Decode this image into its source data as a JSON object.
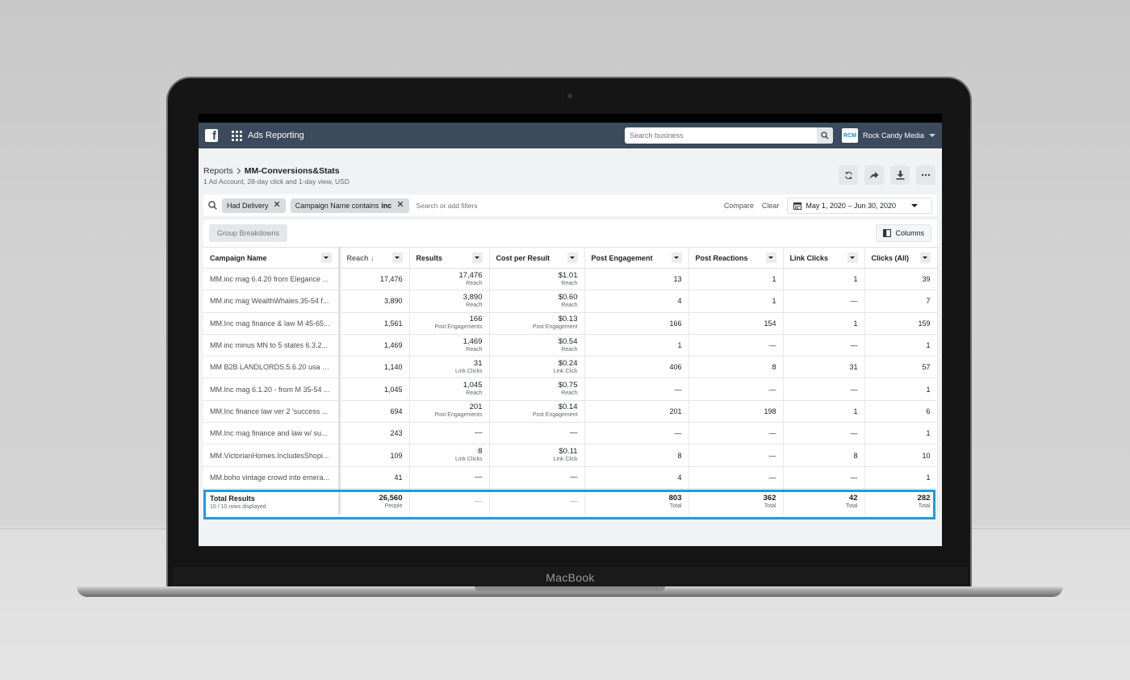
{
  "device": {
    "label": "MacBook"
  },
  "topbar": {
    "app_title": "Ads Reporting",
    "search_placeholder": "Search business",
    "account_logo_text": "RCM",
    "account_name": "Rock Candy Media"
  },
  "header": {
    "breadcrumb_root": "Reports",
    "report_name": "MM-Conversions&Stats",
    "subtitle": "1 Ad Account, 28-day click and 1-day view, USD"
  },
  "filters": {
    "chips": [
      {
        "label": "Had Delivery",
        "bold": ""
      },
      {
        "label": "Campaign Name contains",
        "bold": "inc"
      }
    ],
    "input_placeholder": "Search or add filters",
    "compare_label": "Compare",
    "clear_label": "Clear",
    "date_range": "May 1, 2020 – Jun 30, 2020"
  },
  "tools": {
    "group_breakdowns": "Group Breakdowns",
    "columns": "Columns"
  },
  "table": {
    "columns": [
      "Campaign Name",
      "Reach ↓",
      "Results",
      "Cost per Result",
      "Post Engagement",
      "Post Reactions",
      "Link Clicks",
      "Clicks (All)"
    ],
    "rows": [
      {
        "name": "MM.inc mag 6.4.20 from Elegance ...",
        "reach": "17,476",
        "results": "17,476",
        "results_sub": "Reach",
        "cpr": "$1.01",
        "cpr_sub": "Reach",
        "engagement": "13",
        "reactions": "1",
        "link_clicks": "1",
        "clicks_all": "39"
      },
      {
        "name": "MM.inc mag WealthWhales.35-54 f...",
        "reach": "3,890",
        "results": "3,890",
        "results_sub": "Reach",
        "cpr": "$0.60",
        "cpr_sub": "Reach",
        "engagement": "4",
        "reactions": "1",
        "link_clicks": "—",
        "clicks_all": "7"
      },
      {
        "name": "MM.Inc mag finance & law M 45-65...",
        "reach": "1,561",
        "results": "166",
        "results_sub": "Post Engagements",
        "cpr": "$0.13",
        "cpr_sub": "Post Engagement",
        "engagement": "166",
        "reactions": "154",
        "link_clicks": "1",
        "clicks_all": "159"
      },
      {
        "name": "MM inc minus MN to 5 states 6.3.2...",
        "reach": "1,469",
        "results": "1,469",
        "results_sub": "Reach",
        "cpr": "$0.54",
        "cpr_sub": "Reach",
        "engagement": "1",
        "reactions": "—",
        "link_clicks": "—",
        "clicks_all": "1"
      },
      {
        "name": "MM B2B LANDLORDS.5.6.20 usa fb...",
        "reach": "1,140",
        "results": "31",
        "results_sub": "Link Clicks",
        "cpr": "$0.24",
        "cpr_sub": "Link Click",
        "engagement": "406",
        "reactions": "8",
        "link_clicks": "31",
        "clicks_all": "57"
      },
      {
        "name": "MM.Inc mag 6.1.20 - from M 35-54 ...",
        "reach": "1,045",
        "results": "1,045",
        "results_sub": "Reach",
        "cpr": "$0.75",
        "cpr_sub": "Reach",
        "engagement": "—",
        "reactions": "—",
        "link_clicks": "—",
        "clicks_all": "1"
      },
      {
        "name": "MM.Inc finance law ver 2 'success ...",
        "reach": "694",
        "results": "201",
        "results_sub": "Post Engagements",
        "cpr": "$0.14",
        "cpr_sub": "Post Engagement",
        "engagement": "201",
        "reactions": "198",
        "link_clicks": "1",
        "clicks_all": "6"
      },
      {
        "name": "MM.Inc mag finance and law w/ su...",
        "reach": "243",
        "results": "—",
        "results_sub": "",
        "cpr": "—",
        "cpr_sub": "",
        "engagement": "—",
        "reactions": "—",
        "link_clicks": "—",
        "clicks_all": "1"
      },
      {
        "name": "MM.VictorianHomes.IncludesShopi...",
        "reach": "109",
        "results": "8",
        "results_sub": "Link Clicks",
        "cpr": "$0.11",
        "cpr_sub": "Link Click",
        "engagement": "8",
        "reactions": "—",
        "link_clicks": "8",
        "clicks_all": "10"
      },
      {
        "name": "MM.boho vintage crowd into emera...",
        "reach": "41",
        "results": "—",
        "results_sub": "",
        "cpr": "—",
        "cpr_sub": "",
        "engagement": "4",
        "reactions": "—",
        "link_clicks": "—",
        "clicks_all": "1"
      }
    ],
    "total": {
      "title": "Total Results",
      "subtitle": "10 / 10 rows displayed",
      "reach": "26,560",
      "reach_sub": "People",
      "results": "—",
      "cpr": "—",
      "engagement": "803",
      "engagement_sub": "Total",
      "reactions": "362",
      "reactions_sub": "Total",
      "link_clicks": "42",
      "link_clicks_sub": "Total",
      "clicks_all": "282",
      "clicks_all_sub": "Total"
    }
  },
  "colors": {
    "topbar": "#3b4a5c",
    "highlight": "#1e9be0",
    "account_logo": "#1a8fd6"
  }
}
